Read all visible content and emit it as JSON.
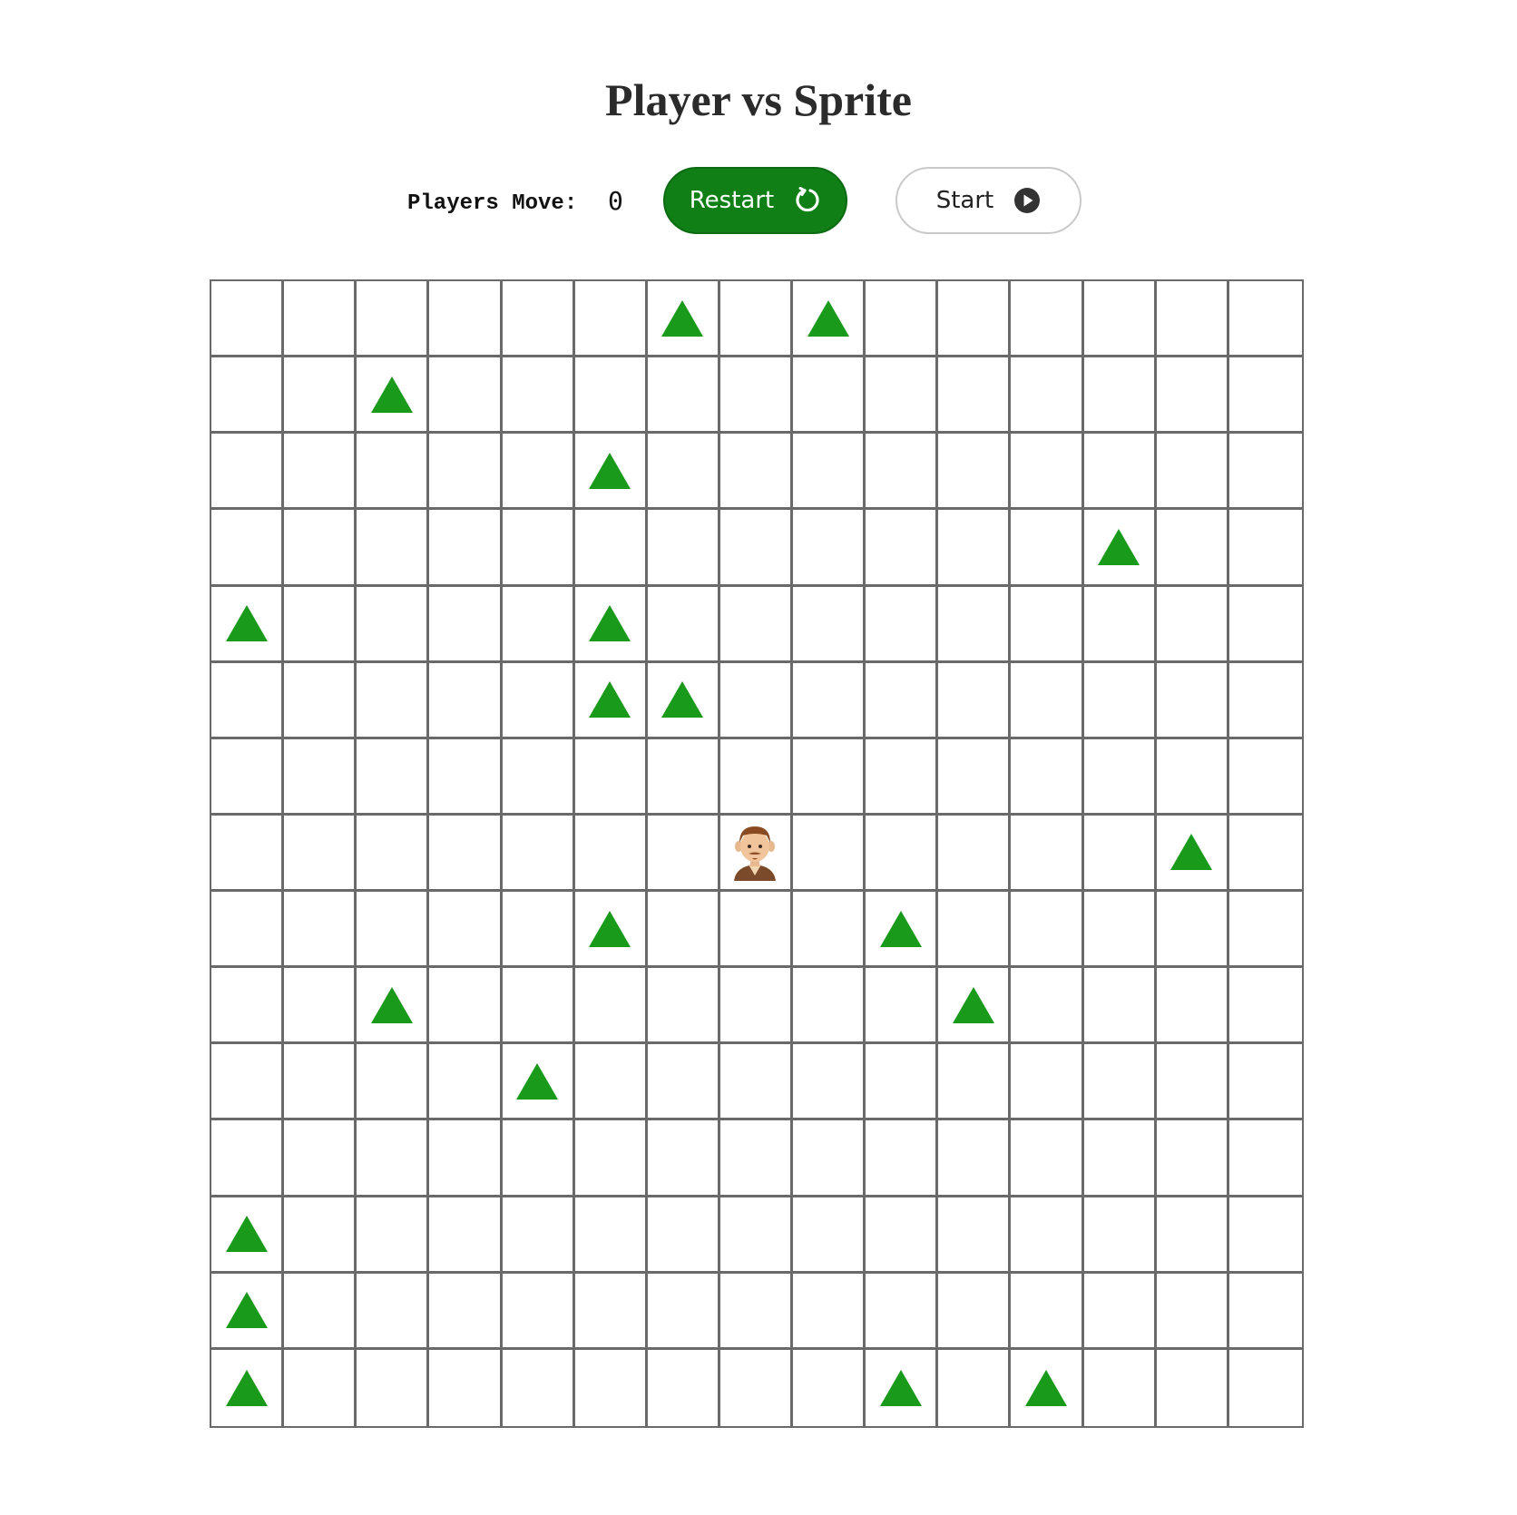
{
  "title": "Player vs Sprite",
  "controls": {
    "moves_label": "Players Move:",
    "moves_count": "0",
    "restart_label": "Restart",
    "start_label": "Start"
  },
  "board": {
    "rows": 15,
    "cols": 15,
    "tree_color": "#1a9a1a",
    "trees": [
      [
        0,
        6
      ],
      [
        0,
        8
      ],
      [
        1,
        2
      ],
      [
        2,
        5
      ],
      [
        3,
        12
      ],
      [
        4,
        0
      ],
      [
        4,
        5
      ],
      [
        5,
        5
      ],
      [
        5,
        6
      ],
      [
        7,
        13
      ],
      [
        8,
        5
      ],
      [
        8,
        9
      ],
      [
        9,
        2
      ],
      [
        9,
        10
      ],
      [
        10,
        4
      ],
      [
        12,
        0
      ],
      [
        13,
        0
      ],
      [
        14,
        0
      ],
      [
        14,
        9
      ],
      [
        14,
        11
      ]
    ],
    "player": [
      7,
      7
    ]
  }
}
